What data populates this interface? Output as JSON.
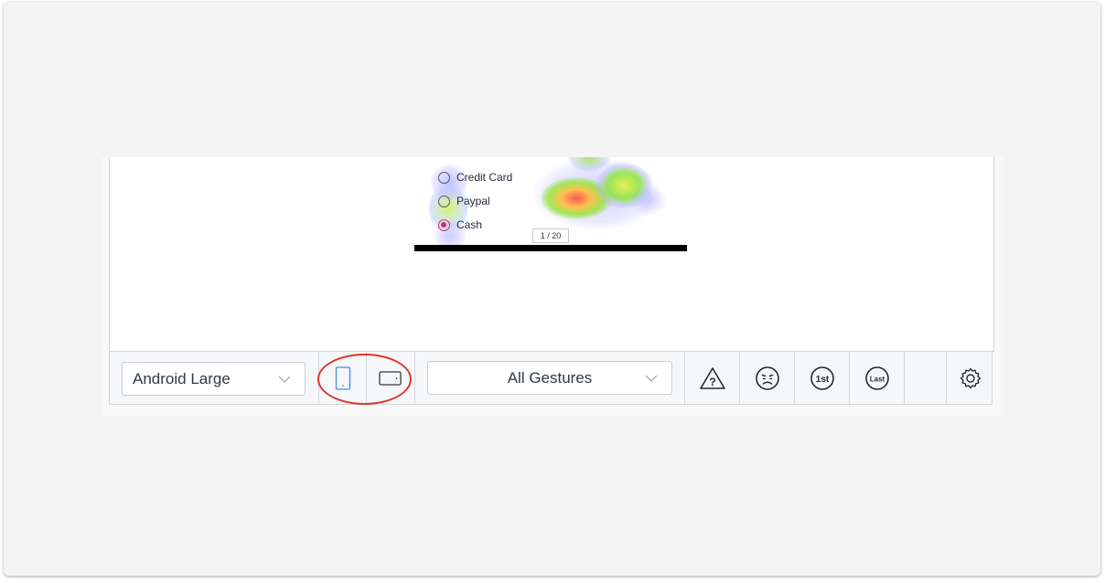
{
  "preview": {
    "options": [
      {
        "label": "Credit Card",
        "checked": false
      },
      {
        "label": "Paypal",
        "checked": false
      },
      {
        "label": "Cash",
        "checked": true
      }
    ],
    "page_counter": "1 / 20"
  },
  "toolbar": {
    "device_select": {
      "value": "Android Large",
      "icon": "chevron-down-icon"
    },
    "orientation": {
      "portrait_icon": "phone-portrait-icon",
      "landscape_icon": "phone-landscape-icon",
      "selected": "portrait"
    },
    "gesture_select": {
      "value": "All Gestures",
      "icon": "chevron-down-icon"
    },
    "filters": [
      {
        "name": "warning-triangle-icon",
        "glyph": "?"
      },
      {
        "name": "frustrated-face-icon"
      },
      {
        "name": "first-session-icon",
        "glyph": "1st"
      },
      {
        "name": "last-session-icon",
        "glyph": "Last"
      }
    ],
    "settings_icon": "gear-icon"
  },
  "colors": {
    "accent_blue": "#3b8ee8",
    "highlight_red": "#e0342b",
    "radio_checked": "#c7335d"
  }
}
